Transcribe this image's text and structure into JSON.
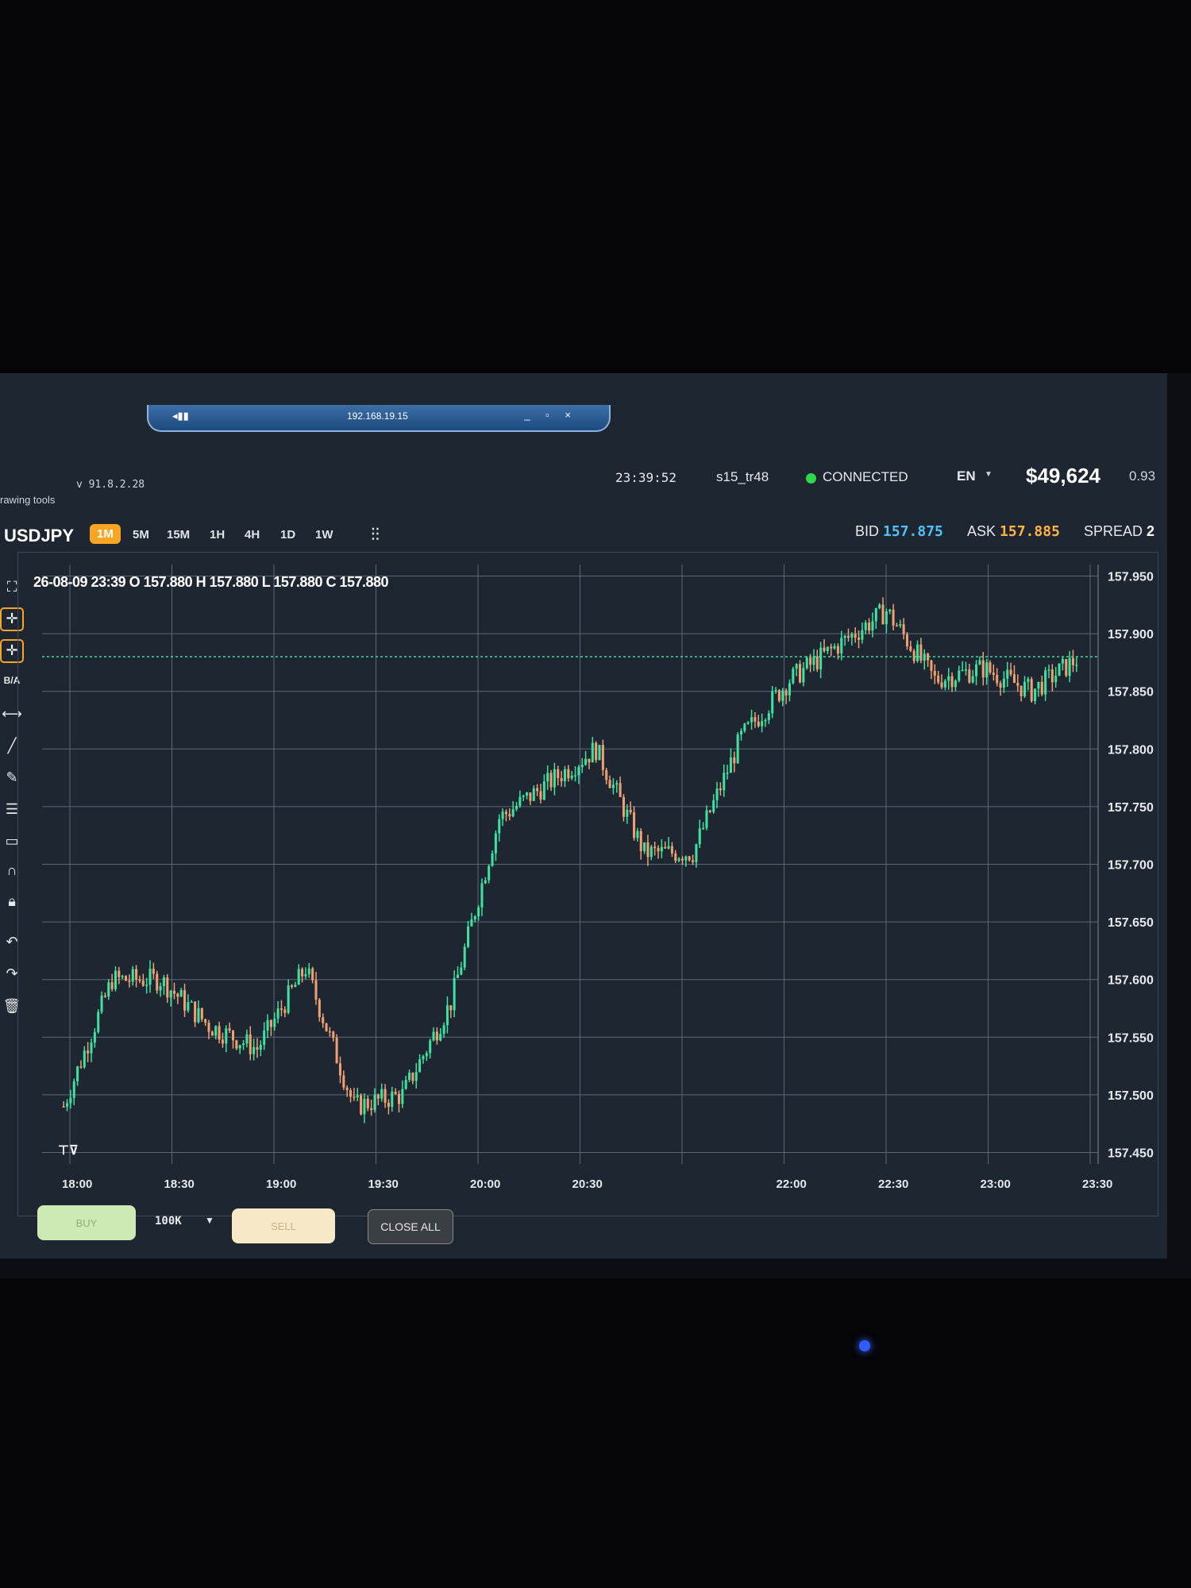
{
  "remote": {
    "ip": "192.168.19.15",
    "signal_icon": "signal-icon",
    "controls": "_ ▫ ×"
  },
  "header": {
    "version": "v 91.8.2.28",
    "drawing_tools_label": "rawing tools",
    "clock": "23:39:52",
    "user": "s15_tr48",
    "connection_status": "CONNECTED",
    "language": "EN",
    "balance": "$49,624",
    "ratio": "0.93"
  },
  "instrument": {
    "symbol": "USDJPY",
    "timeframes": [
      "1M",
      "5M",
      "15M",
      "1H",
      "4H",
      "1D",
      "1W"
    ],
    "active_timeframe": "1M",
    "bid_label": "BID",
    "bid": "157.875",
    "ask_label": "ASK",
    "ask": "157.885",
    "spread_label": "SPREAD",
    "spread": "2"
  },
  "ohlc_readout": "26-08-09 23:39 O 157.880 H 157.880 L 157.880 C 157.880",
  "toolbar": {
    "ba_label": "B/A",
    "icons": [
      "expand-icon",
      "crosshair-icon",
      "crosshair-add-icon",
      "measure-icon",
      "line-icon",
      "pencil-icon",
      "fibonacci-icon",
      "rectangle-icon",
      "magnet-icon",
      "lock-icon",
      "undo-icon",
      "redo-icon",
      "trash-icon"
    ]
  },
  "order_panel": {
    "buy_label": "BUY",
    "quantity": "100K",
    "sell_label": "SELL",
    "close_all_label": "CLOSE ALL"
  },
  "colors": {
    "up": "#3fe0a0",
    "down": "#f0a070",
    "bid": "#4fc3f7",
    "ask": "#ffb340",
    "active_tf": "#f6a623",
    "price_line": "#3fe0a0"
  },
  "chart_data": {
    "type": "candlestick",
    "ylim": [
      157.44,
      157.96
    ],
    "y_ticks": [
      "157.950",
      "157.900",
      "157.850",
      "157.800",
      "157.750",
      "157.700",
      "157.650",
      "157.600",
      "157.550",
      "157.500",
      "157.450"
    ],
    "x_ticks": [
      "18:00",
      "18:30",
      "19:00",
      "19:30",
      "20:00",
      "20:30",
      "",
      "22:00",
      "22:30",
      "23:00",
      "23:30"
    ],
    "current_price": 157.88,
    "series": [
      {
        "x": "18:00",
        "close": 157.49
      },
      {
        "x": "18:15",
        "close": 157.6
      },
      {
        "x": "18:30",
        "close": 157.6
      },
      {
        "x": "18:45",
        "close": 157.56
      },
      {
        "x": "19:00",
        "close": 157.54
      },
      {
        "x": "19:15",
        "close": 157.61
      },
      {
        "x": "19:30",
        "close": 157.49
      },
      {
        "x": "19:45",
        "close": 157.5
      },
      {
        "x": "20:00",
        "close": 157.58
      },
      {
        "x": "20:15",
        "close": 157.74
      },
      {
        "x": "20:30",
        "close": 157.77
      },
      {
        "x": "20:45",
        "close": 157.8
      },
      {
        "x": "21:00",
        "close": 157.71
      },
      {
        "x": "21:30",
        "close": 157.71
      },
      {
        "x": "22:00",
        "close": 157.81
      },
      {
        "x": "22:15",
        "close": 157.86
      },
      {
        "x": "22:30",
        "close": 157.89
      },
      {
        "x": "22:45",
        "close": 157.92
      },
      {
        "x": "23:00",
        "close": 157.86
      },
      {
        "x": "23:15",
        "close": 157.87
      },
      {
        "x": "23:30",
        "close": 157.85
      },
      {
        "x": "23:39",
        "close": 157.88
      }
    ]
  }
}
